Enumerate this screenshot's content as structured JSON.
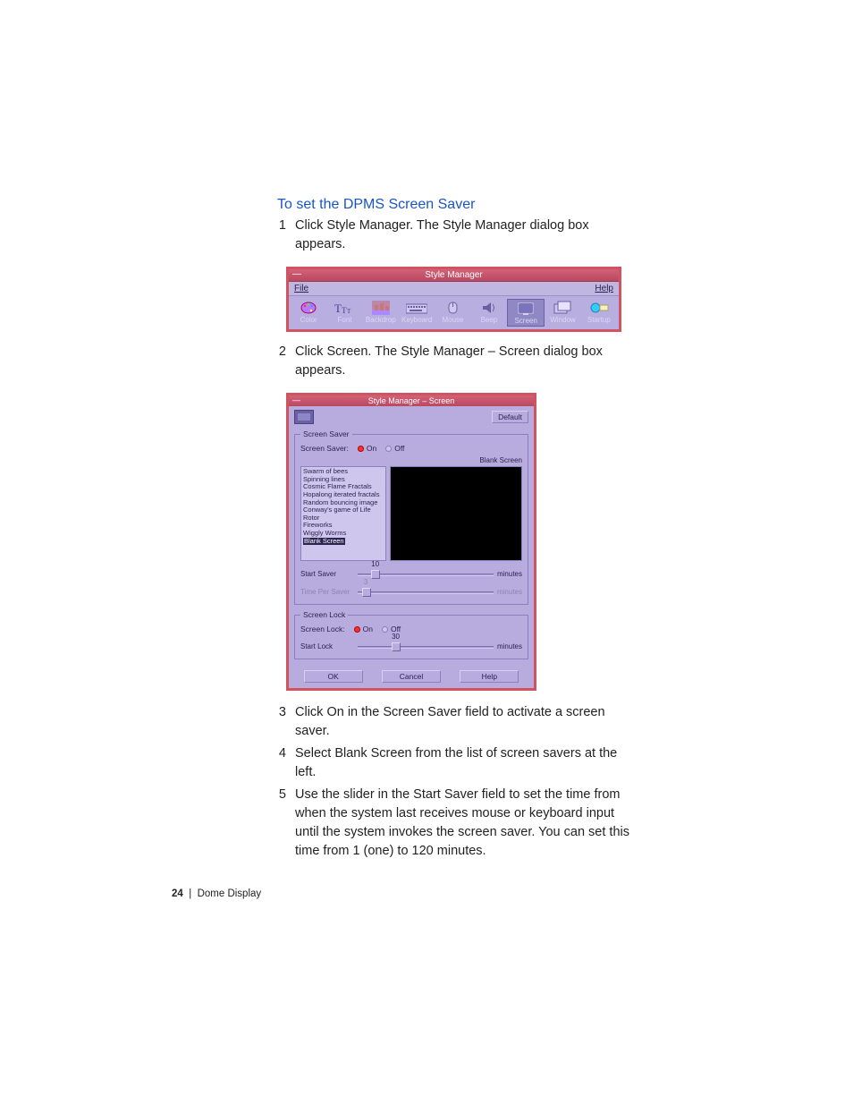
{
  "heading": "To set the DPMS Screen Saver",
  "steps": {
    "s1": "Click Style Manager. The Style Manager dialog box appears.",
    "s2": "Click Screen. The Style Manager – Screen dialog box appears.",
    "s3": "Click On in the Screen Saver field to activate a screen saver.",
    "s4": "Select Blank Screen from the list of screen savers at the left.",
    "s5": "Use the slider in the Start Saver field to set the time from when the system last receives mouse or keyboard input until the system invokes the screen saver. You can set this time from 1 (one) to 120 minutes."
  },
  "nums": {
    "n1": "1",
    "n2": "2",
    "n3": "3",
    "n4": "4",
    "n5": "5"
  },
  "style_manager": {
    "title": "Style Manager",
    "menu": {
      "file": "File",
      "help": "Help"
    },
    "toolbar": [
      "Color",
      "Font",
      "Backdrop",
      "Keyboard",
      "Mouse",
      "Beep",
      "Screen",
      "Window",
      "Startup"
    ],
    "selected": "Screen"
  },
  "screen_dialog": {
    "title": "Style Manager – Screen",
    "default_btn": "Default",
    "saver": {
      "legend": "Screen Saver",
      "label": "Screen Saver:",
      "on": "On",
      "off": "Off",
      "preview_label": "Blank Screen",
      "list": [
        "Swarm of bees",
        "Spinning lines",
        "Cosmic Flame Fractals",
        "Hopalong iterated fractals",
        "Random bouncing image",
        "Conway's game of Life",
        "Rotor",
        "Fireworks",
        "Wiggly Worms",
        "Blank Screen"
      ],
      "list_selected": "Blank Screen",
      "start_label": "Start Saver",
      "start_value": "10",
      "time_label": "Time Per Saver",
      "time_value": "3",
      "unit": "minutes"
    },
    "lock": {
      "legend": "Screen Lock",
      "label": "Screen Lock:",
      "on": "On",
      "off": "Off",
      "start_label": "Start Lock",
      "start_value": "30",
      "unit": "minutes"
    },
    "buttons": {
      "ok": "OK",
      "cancel": "Cancel",
      "help": "Help"
    }
  },
  "footer": {
    "page": "24",
    "sep": "|",
    "title": "Dome Display"
  }
}
